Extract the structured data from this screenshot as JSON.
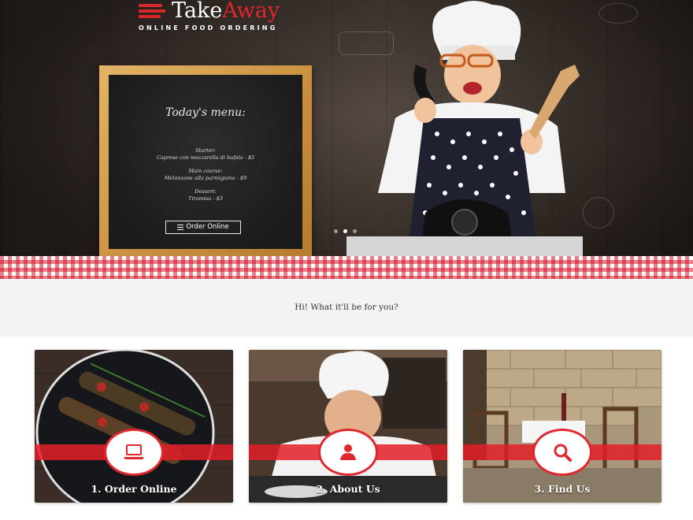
{
  "brand": {
    "name_part1": "Take",
    "name_part2": "Away",
    "tagline": "ONLINE FOOD ORDERING",
    "accent_color": "#e3262d"
  },
  "hero": {
    "menu_board": {
      "title": "Today's menu:",
      "lines": [
        "Starter:",
        "Caprese con mozzarella di bufala - $5",
        "Main course:",
        "Melanzane alla parmigiana - $9",
        "Dessert:",
        "Tiramisu - $3"
      ],
      "button_label": "Order Online",
      "button_icon": "list-icon"
    },
    "slides": {
      "count": 3,
      "active": 1
    }
  },
  "greeting": {
    "text": "Hi! What it'll be for you?"
  },
  "cards": [
    {
      "label": "1. Order Online",
      "icon": "laptop-icon"
    },
    {
      "label": "2. About Us",
      "icon": "user-icon"
    },
    {
      "label": "3. Find Us",
      "icon": "search-icon"
    }
  ]
}
